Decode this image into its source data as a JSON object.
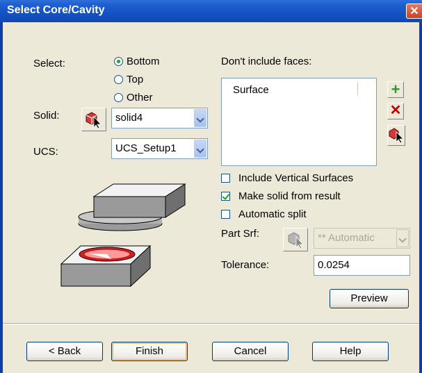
{
  "window": {
    "title": "Select Core/Cavity",
    "close_glyph": "✕"
  },
  "select": {
    "label": "Select:",
    "options": [
      "Bottom",
      "Top",
      "Other"
    ],
    "selected": "Bottom"
  },
  "solid": {
    "label": "Solid:",
    "value": "solid4"
  },
  "ucs": {
    "label": "UCS:",
    "value": "UCS_Setup1"
  },
  "faces": {
    "label": "Don't include faces:",
    "column": "Surface"
  },
  "checks": {
    "vertical": {
      "label": "Include Vertical Surfaces",
      "checked": false
    },
    "make_solid": {
      "label": "Make solid from result",
      "checked": true
    },
    "auto_split": {
      "label": "Automatic split",
      "checked": false
    }
  },
  "part_srf": {
    "label": "Part Srf:",
    "value": "** Automatic"
  },
  "tolerance": {
    "label": "Tolerance:",
    "value": "0.0254"
  },
  "buttons": {
    "preview": "Preview",
    "back": "< Back",
    "finish": "Finish",
    "cancel": "Cancel",
    "help": "Help"
  },
  "icons": {
    "add": "plus-icon",
    "remove": "x-icon",
    "pick": "pick-solid-icon"
  },
  "colors": {
    "title_bar": "#1452c4",
    "add": "#21a121",
    "remove": "#c00000"
  }
}
